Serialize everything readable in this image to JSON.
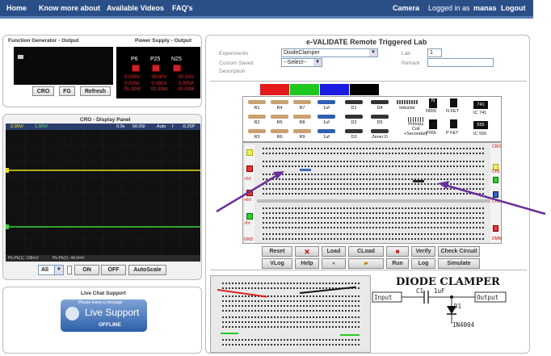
{
  "nav": {
    "left": [
      "Home",
      "Know more about",
      "Available Videos",
      "FAQ's"
    ],
    "camera": "Camera",
    "logged_prefix": "Logged in as",
    "user": "manas",
    "logout": "Logout"
  },
  "fg": {
    "title": "Function Generator - Output",
    "ps_title": "Power Supply - Output",
    "channels": [
      "P6",
      "P25",
      "N25"
    ],
    "readings": {
      "v": [
        "0.000V",
        "00.00V",
        "00.00V"
      ],
      "a": [
        "0.000A",
        "0.000A",
        "0.000A"
      ],
      "w": [
        "00.00W",
        "00.00W",
        "00.00W"
      ]
    },
    "buttons": {
      "cro": "CRO",
      "fg": "FG",
      "refresh": "Refresh"
    }
  },
  "cro": {
    "title": "CRO - Display Panel",
    "header": {
      "ch1": "2.00V/",
      "ch2": "1.00V/",
      "time": "0.0s",
      "rate": "50.0S/",
      "mode": "Auto",
      "trig": "f",
      "level": "-6.25P"
    },
    "footer": {
      "m1": "Pk-Pk(1): 198mV",
      "m2": "Pk-Pk(1): 44.0mV"
    },
    "select_value": "All",
    "buttons": {
      "on": "ON",
      "off": "OFF",
      "autoscale": "AutoScale"
    }
  },
  "chat": {
    "title": "Live Chat Support",
    "banner_top": "Please leave a message",
    "banner_main": "Live Support",
    "status": "OFFLINE"
  },
  "lab": {
    "title": "e-VALIDATE Remote Triggered Lab",
    "experiments_label": "Experiments",
    "experiment_value": "DiodeClamper",
    "custom_label": "Custom Saved",
    "custom_value": "--Select--",
    "description_label": "Description",
    "lab_label": "Lab",
    "lab_value": "1",
    "remark_label": "Remark",
    "remark_value": "",
    "colors": [
      "#e31b1b",
      "#1ec81e",
      "#1a1ae0",
      "#000000"
    ],
    "components": {
      "row1": [
        "R1",
        "R4",
        "R7",
        "1uf",
        "D1",
        "D4",
        "Inductor"
      ],
      "row2": [
        "R2",
        "R5",
        "R8",
        "1uf",
        "D2",
        "D5"
      ],
      "row3": [
        "R3",
        "R6",
        "R9",
        "1uf",
        "D3",
        "Zener D"
      ],
      "transformer": [
        "Primary",
        "Coil",
        "+Secondary"
      ],
      "transistors": [
        "N",
        "N555",
        "N FET",
        "P055",
        "P FET"
      ],
      "ics": [
        "741",
        "IC 741",
        "555",
        "IC 555"
      ]
    },
    "breadboard_labels": {
      "left": [
        "+5V",
        "+6V",
        "-6V",
        "GND"
      ],
      "right": [
        "CRO",
        "CH1",
        "CH2",
        "DMM"
      ]
    },
    "buttons_row1": [
      "Reset",
      "Load",
      "CLoad",
      "Verify",
      "Check Circuit"
    ],
    "buttons_row2": [
      "VLog",
      "Help",
      "Run",
      "Log",
      "Simulate"
    ],
    "circuit_title": "DIODE CLAMPER",
    "circuit": {
      "input": "Input",
      "output": "Output",
      "cap_name": "C1",
      "cap_value": "1uF",
      "diode_name": "D1",
      "diode_part": "1N4004"
    }
  }
}
